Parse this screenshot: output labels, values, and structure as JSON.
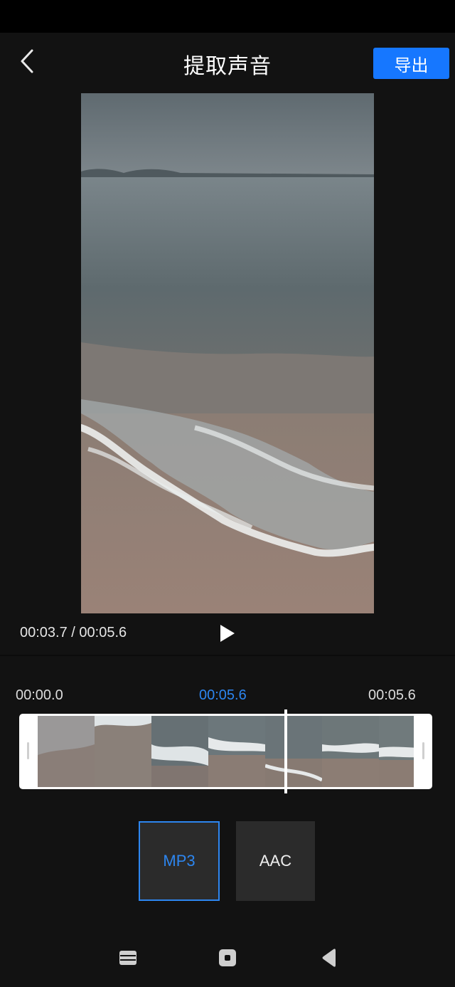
{
  "header": {
    "title": "提取声音",
    "export_label": "导出"
  },
  "player": {
    "time_readout": "00:03.7 / 00:05.6"
  },
  "timeline": {
    "start_label": "00:00.0",
    "current_label": "00:05.6",
    "end_label": "00:05.6"
  },
  "formats": {
    "mp3_label": "MP3",
    "aac_label": "AAC",
    "selected": "MP3"
  },
  "colors": {
    "accent": "#1677ff",
    "selected_text": "#2d86f0",
    "background": "#121212"
  },
  "icons": {
    "back": "chevron-left-icon",
    "play": "play-icon",
    "nav_recent": "recent-apps-icon",
    "nav_home": "home-icon",
    "nav_back": "nav-back-icon"
  }
}
